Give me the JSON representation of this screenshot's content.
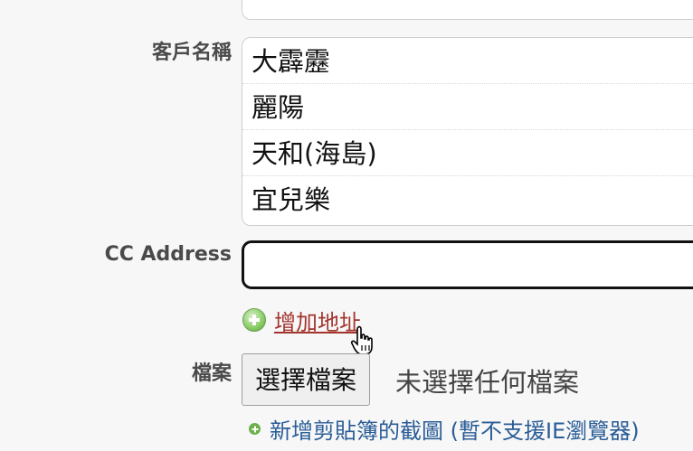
{
  "form": {
    "customer_label": "客戶名稱",
    "customers": [
      "大霹靂",
      "麗陽",
      "天和(海島)",
      "宜兒樂"
    ],
    "cc_label": "CC Address",
    "cc_value": "",
    "add_address_label": "增加地址",
    "file_label": "檔案",
    "choose_file_button": "選擇檔案",
    "no_file_text": "未選擇任何檔案",
    "paste_screenshot_link": "新增剪貼簿的截圖 (暫不支援IE瀏覽器)"
  },
  "colors": {
    "link_red": "#a3352e",
    "link_blue": "#2a5d97",
    "label": "#4a4a4a"
  },
  "icons": {
    "add": "plus-circle-icon",
    "cursor": "hand-pointer-icon",
    "bullet": "small-plus-icon"
  }
}
